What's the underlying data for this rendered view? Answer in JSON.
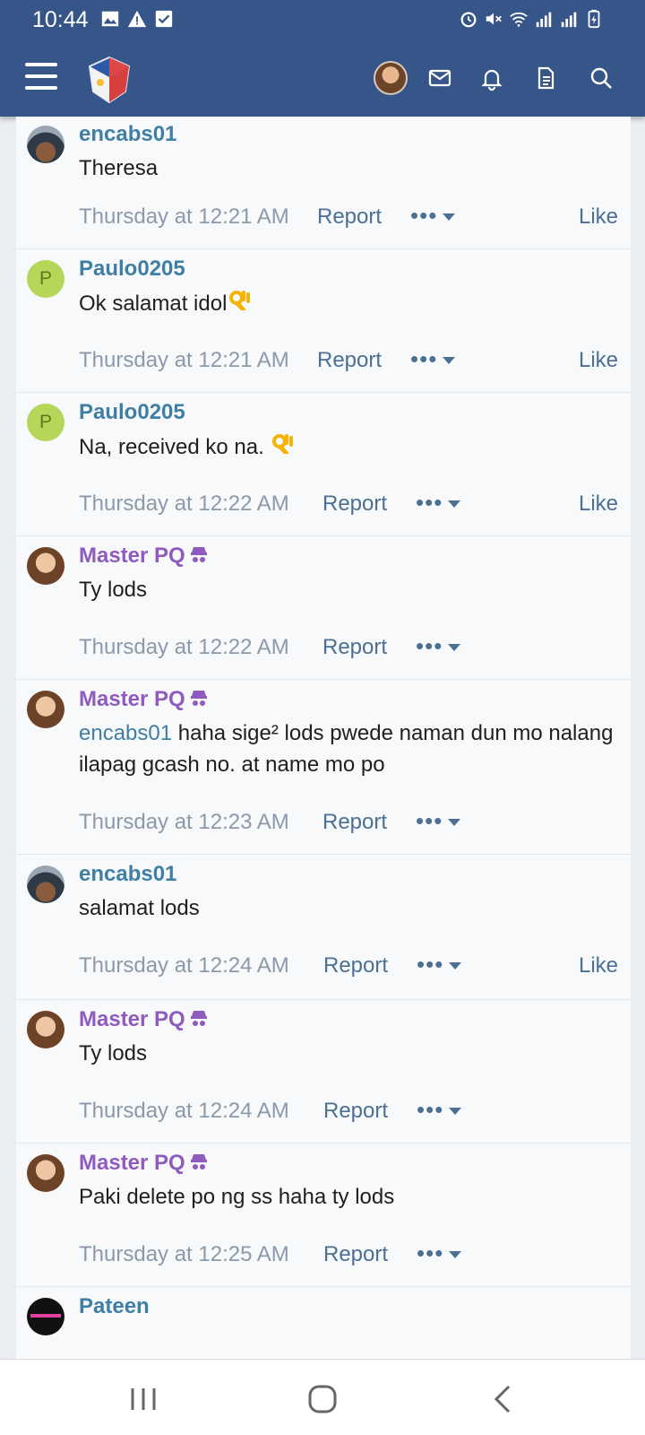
{
  "status_bar": {
    "time": "10:44",
    "left_icons": [
      "image-icon",
      "warning-icon",
      "check-box-icon"
    ],
    "right_icons": [
      "alarm-icon",
      "mute-icon",
      "wifi-icon",
      "signal-icon",
      "signal-icon",
      "battery-icon"
    ]
  },
  "app_bar": {
    "icons": [
      "menu-icon",
      "site-logo",
      "user-avatar",
      "mail-icon",
      "bell-icon",
      "document-icon",
      "search-icon"
    ],
    "bg_color": "#36568a"
  },
  "posts": [
    {
      "author": "encabs01",
      "staff": false,
      "avatar": "man",
      "text": "Theresa",
      "emoji": false,
      "timestamp": "Thursday at 12:21 AM",
      "report": "Report",
      "like": "Like",
      "show_like": true
    },
    {
      "author": "Paulo0205",
      "staff": false,
      "avatar": "letter",
      "avatar_letter": "P",
      "text": "Ok salamat idol",
      "emoji": true,
      "timestamp": "Thursday at 12:21 AM",
      "report": "Report",
      "like": "Like",
      "show_like": true
    },
    {
      "author": "Paulo0205",
      "staff": false,
      "avatar": "letter",
      "avatar_letter": "P",
      "text": "Na, received ko na.",
      "emoji": true,
      "timestamp": "Thursday at 12:22 AM",
      "report": "Report",
      "like": "Like",
      "show_like": true
    },
    {
      "author": "Master PQ",
      "staff": true,
      "avatar": "woman",
      "text": "Ty lods",
      "emoji": false,
      "timestamp": "Thursday at 12:22 AM",
      "report": "Report",
      "like": "",
      "show_like": false
    },
    {
      "author": "Master PQ",
      "staff": true,
      "avatar": "woman",
      "mention": "encabs01",
      "text": " haha sige² lods pwede naman dun mo nalang ilapag gcash no. at name mo po",
      "emoji": false,
      "timestamp": "Thursday at 12:23 AM",
      "report": "Report",
      "like": "",
      "show_like": false
    },
    {
      "author": "encabs01",
      "staff": false,
      "avatar": "man",
      "text": "salamat lods",
      "emoji": false,
      "timestamp": "Thursday at 12:24 AM",
      "report": "Report",
      "like": "Like",
      "show_like": true
    },
    {
      "author": "Master PQ",
      "staff": true,
      "avatar": "woman",
      "text": "Ty lods",
      "emoji": false,
      "timestamp": "Thursday at 12:24 AM",
      "report": "Report",
      "like": "",
      "show_like": false
    },
    {
      "author": "Master PQ",
      "staff": true,
      "avatar": "woman",
      "text": "Paki delete po ng ss haha ty lods",
      "emoji": false,
      "timestamp": "Thursday at 12:25 AM",
      "report": "Report",
      "like": "",
      "show_like": false
    },
    {
      "author": "Pateen",
      "staff": false,
      "avatar": "dark",
      "text": "",
      "emoji": false,
      "timestamp": "",
      "report": "",
      "like": "",
      "show_like": false
    }
  ],
  "nav_bar": {
    "icons": [
      "recent-apps-icon",
      "home-icon",
      "back-icon"
    ]
  }
}
